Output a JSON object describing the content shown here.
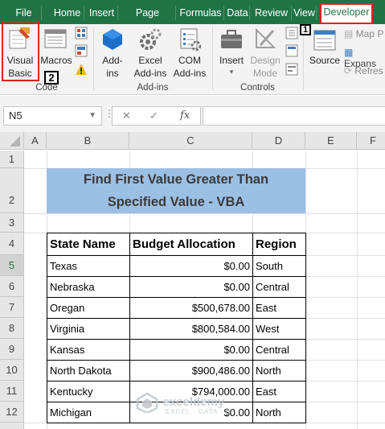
{
  "tabs": [
    {
      "label": "File"
    },
    {
      "label": "Home"
    },
    {
      "label": "Insert"
    },
    {
      "label": "Page Layout"
    },
    {
      "label": "Formulas"
    },
    {
      "label": "Data"
    },
    {
      "label": "Review"
    },
    {
      "label": "View"
    },
    {
      "label": "Developer"
    }
  ],
  "ribbon": {
    "code_group": {
      "visual_basic_line1": "Visual",
      "visual_basic_line2": "Basic",
      "macros": "Macros",
      "label": "Code"
    },
    "addins_group": {
      "addins_line1": "Add-",
      "addins_line2": "ins",
      "excel_addins_line1": "Excel",
      "excel_addins_line2": "Add-ins",
      "com_addins_line1": "COM",
      "com_addins_line2": "Add-ins",
      "label": "Add-ins"
    },
    "controls_group": {
      "insert": "Insert",
      "design_mode_line1": "Design",
      "design_mode_line2": "Mode",
      "label": "Controls"
    },
    "xml_group": {
      "source": "Source",
      "map_properties": "Map P",
      "expansion_packs": "Expans",
      "refresh_data": "Refres"
    },
    "callout_1": "1",
    "callout_2": "2"
  },
  "formula_bar": {
    "name_box": "N5",
    "cancel_symbol": "✕",
    "enter_symbol": "✓",
    "fx_symbol": "fx",
    "formula": ""
  },
  "columns": [
    "A",
    "B",
    "C",
    "D",
    "E",
    "F"
  ],
  "rows": [
    "1",
    "2",
    "3",
    "4",
    "5",
    "6",
    "7",
    "8",
    "9",
    "10",
    "11",
    "12"
  ],
  "sheet": {
    "title_line1": "Find First Value Greater Than",
    "title_line2": "Specified Value - VBA",
    "headers": [
      "State Name",
      "Budget Allocation",
      "Region"
    ],
    "data": [
      [
        "Texas",
        "$0.00",
        "South"
      ],
      [
        "Nebraska",
        "$0.00",
        "Central"
      ],
      [
        "Oregan",
        "$500,678.00",
        "East"
      ],
      [
        "Virginia",
        "$800,584.00",
        "West"
      ],
      [
        "Kansas",
        "$0.00",
        "Central"
      ],
      [
        "North Dakota",
        "$900,486.00",
        "North"
      ],
      [
        "Kentucky",
        "$794,000.00",
        "East"
      ],
      [
        "Michigan",
        "$0.00",
        "North"
      ]
    ]
  },
  "watermark": {
    "line1": "exceldemy",
    "line2": "EXCEL · DATA · BI"
  },
  "colors": {
    "excel_green": "#217346",
    "highlight_red": "#e0221f",
    "title_fill": "#9cbfe4"
  }
}
